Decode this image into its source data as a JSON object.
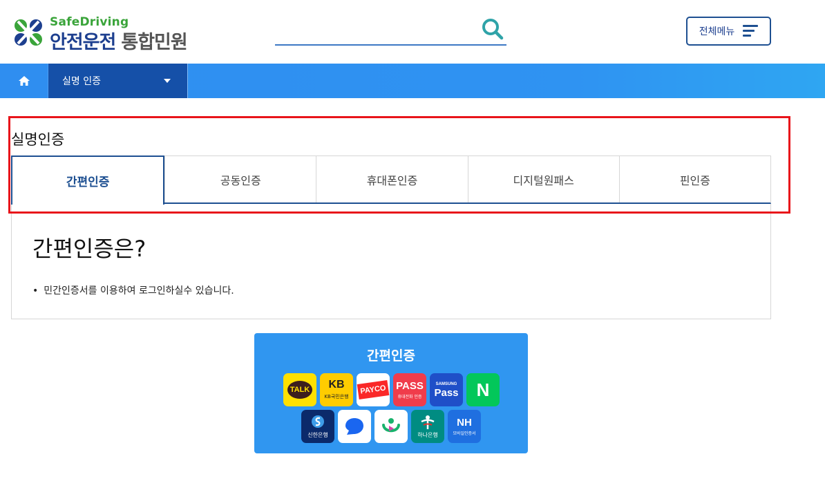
{
  "header": {
    "logo_sub": "SafeDriving",
    "logo_main": "안전운전",
    "logo_main_gray": "통합민원",
    "menu_label": "전체메뉴",
    "search_placeholder": ""
  },
  "navbar": {
    "current": "실명 인증"
  },
  "section": {
    "title": "실명인증"
  },
  "tabs": [
    {
      "label": "간편인증",
      "active": true
    },
    {
      "label": "공동인증",
      "active": false
    },
    {
      "label": "휴대폰인증",
      "active": false
    },
    {
      "label": "디지털원패스",
      "active": false
    },
    {
      "label": "핀인증",
      "active": false
    }
  ],
  "content": {
    "heading": "간편인증은?",
    "bullet": "민간인증서를 이용하여 로그인하실수 있습니다."
  },
  "auth_card": {
    "title": "간편인증",
    "providers": {
      "kakao": "TALK",
      "kb_main": "KB",
      "kb_sub": "KB국민은행",
      "payco": "PAYCO",
      "pass_main": "PASS",
      "pass_sub": "휴대전화 인증",
      "samsung_top": "SAMSUNG",
      "samsung_main": "Pass",
      "naver": "N",
      "shinhan": "신한은행",
      "hana": "하나은행",
      "nh_main": "NH",
      "nh_sub": "모바일인증서"
    }
  },
  "colors": {
    "brand_blue": "#1d4f91",
    "nav_blue": "#2f8ef0",
    "highlight_red": "#e8141a",
    "logo_green": "#3aa43a"
  }
}
